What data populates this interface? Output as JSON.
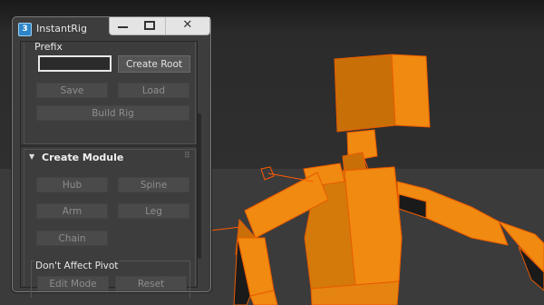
{
  "window": {
    "icon_text": "3",
    "title": "InstantRig",
    "controls": {
      "minimize": "minimize",
      "maximize": "maximize",
      "close": "✕"
    }
  },
  "rig": {
    "prefix_label": "Prefix",
    "prefix_value": "",
    "create_root": "Create Root",
    "save": "Save",
    "load": "Load",
    "build_rig": "Build Rig"
  },
  "module": {
    "arrow": "▼",
    "title": "Create Module",
    "grip": "⠿",
    "buttons": {
      "hub": "Hub",
      "spine": "Spine",
      "arm": "Arm",
      "leg": "Leg",
      "chain": "Chain"
    },
    "pivot": {
      "label": "Don't Affect Pivot",
      "edit_mode": "Edit Mode",
      "reset": "Reset"
    }
  },
  "colors": {
    "mesh_orange": "#f08a10",
    "mesh_dark": "#c96f08",
    "wire": "#ff5a00",
    "panel_bg": "#3d3d3d"
  }
}
